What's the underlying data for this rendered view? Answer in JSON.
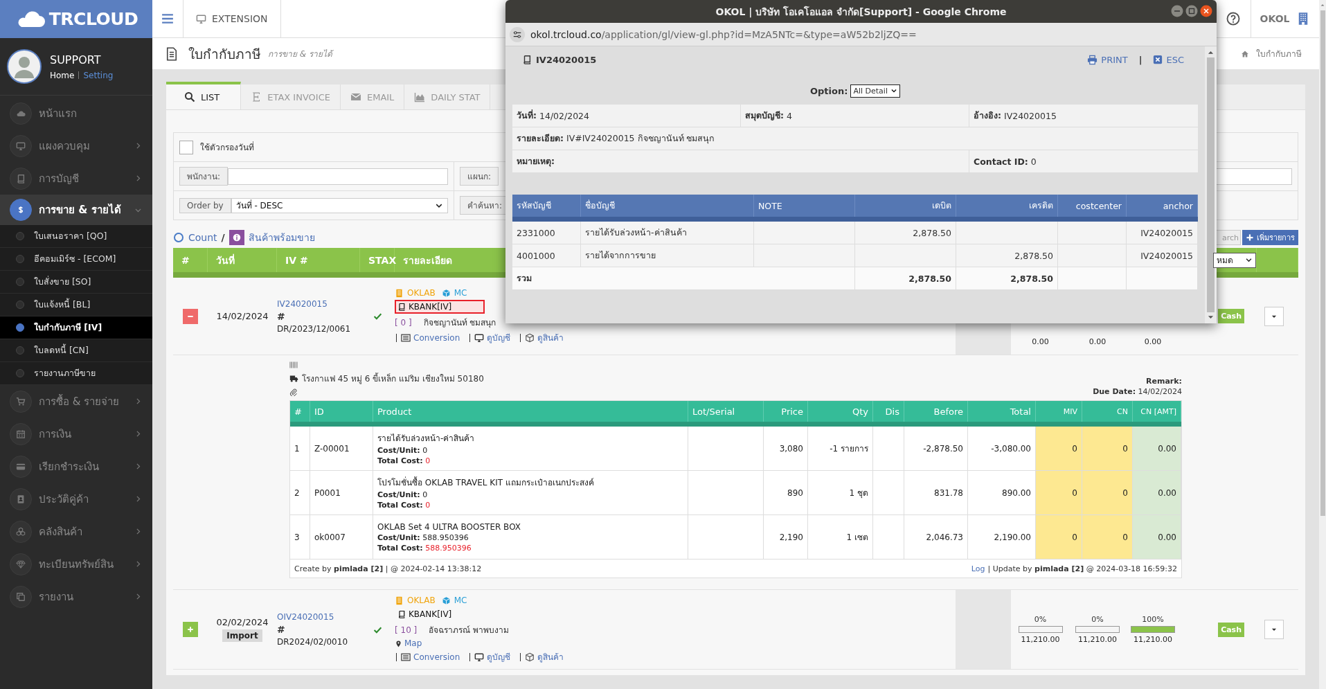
{
  "app": {
    "logo": "TRCLOUD",
    "user": "SUPPORT",
    "home_link": "Home",
    "setting_link": "Setting",
    "extension": "EXTENSION",
    "company": "OKOL"
  },
  "sidebar": {
    "items": [
      {
        "label": "หน้าแรก",
        "selected": false
      },
      {
        "label": "แผงควบคุม",
        "selected": false,
        "expanded": false
      },
      {
        "label": "การบัญชี",
        "selected": false,
        "expanded": false
      },
      {
        "label": "การขาย & รายได้",
        "selected": true,
        "expanded": true,
        "children": [
          {
            "label": "ใบเสนอราคา [QO]",
            "selected": false
          },
          {
            "label": "อีคอมเมิร์ซ - [ECOM]",
            "selected": false
          },
          {
            "label": "ใบสั่งขาย [SO]",
            "selected": false
          },
          {
            "label": "ใบแจ้งหนี้ [BL]",
            "selected": false
          },
          {
            "label": "ใบกำกับภาษี [IV]",
            "selected": true
          },
          {
            "label": "ใบลดหนี้ [CN]",
            "selected": false
          },
          {
            "label": "รายงานภาษีขาย",
            "selected": false
          }
        ]
      },
      {
        "label": "การซื้อ & รายจ่าย",
        "selected": false,
        "expanded": false
      },
      {
        "label": "การเงิน",
        "selected": false,
        "expanded": false
      },
      {
        "label": "เรียกชำระเงิน",
        "selected": false,
        "expanded": false
      },
      {
        "label": "ประวัติคู่ค้า",
        "selected": false,
        "expanded": false
      },
      {
        "label": "คลังสินค้า",
        "selected": false,
        "expanded": false
      },
      {
        "label": "ทะเบียนทรัพย์สิน",
        "selected": false,
        "expanded": false
      },
      {
        "label": "รายงาน",
        "selected": false,
        "expanded": false
      }
    ]
  },
  "page": {
    "title": "ใบกำกับภาษี",
    "subtitle": "การขาย & รายได้",
    "breadcrumb": "ใบกำกับภาษี"
  },
  "tabs": [
    {
      "label": "LIST",
      "selected": true
    },
    {
      "label": "ETAX INVOICE",
      "selected": false
    },
    {
      "label": "EMAIL",
      "selected": false
    },
    {
      "label": "DAILY STAT",
      "selected": false
    }
  ],
  "filters": {
    "date_filter": {
      "label": "ใช้ตัวกรองวันที่",
      "checked": false
    },
    "employee_label": "พนักงาน:",
    "department_label": "แผนก:",
    "order_label": "Order by",
    "order_value": "วันที่ - DESC",
    "search_label": "คำค้นหา:"
  },
  "toolbar": {
    "count": "Count",
    "separator": "/",
    "stock_link": "สินค้าพร้อมขาย",
    "search_button": "arch",
    "add_button": "เพิ่มรายการ"
  },
  "table": {
    "columns": [
      "#",
      "วันที่",
      "IV #",
      "STAX",
      "รายละเอียด"
    ],
    "status_select": "หมด",
    "rows": [
      {
        "expanded": true,
        "date": "14/02/2024",
        "iv": "IV24020015",
        "hash": "#",
        "ref": "DR/2023/12/0061",
        "stax": true,
        "company": "OKLAB",
        "branch": "MC",
        "book": "KBANK[IV]",
        "highlighted": true,
        "contact_code": "[ 0 ]",
        "contact": "กิจชญานันท์ ชมสนุก",
        "links": [
          "Conversion",
          "ดูบัญชี",
          "ดูสินค้า"
        ],
        "progress": [
          {
            "amount": "0.00"
          },
          {
            "amount": "0.00"
          },
          {
            "amount": "0.00"
          }
        ],
        "payment": "Cash",
        "detail": {
          "address": "โรงกาแฟ 45 หมู่ 6 ขี้เหล็ก แม่ริม เชียงใหม่ 50180",
          "remark_label": "Remark:",
          "due_label": "Due Date:",
          "due_date": "14/02/2024",
          "columns": [
            "#",
            "ID",
            "Product",
            "Lot/Serial",
            "Price",
            "Qty",
            "Dis",
            "Before",
            "Total",
            "MIV",
            "CN",
            "CN [AMT]"
          ],
          "items": [
            {
              "no": "1",
              "id": "Z-00001",
              "product": "รายได้รับล่วงหน้า-ค่าสินค้า",
              "cost_unit_label": "Cost/Unit:",
              "cost_unit": "0",
              "total_cost_label": "Total Cost:",
              "total_cost": "0",
              "price": "3,080",
              "qty": "-1 รายการ",
              "before": "-2,878.50",
              "total": "-3,080.00",
              "miv": "0",
              "cn": "0",
              "cn_amt": "0.00"
            },
            {
              "no": "2",
              "id": "P0001",
              "product": "โปรโมชั่นซื้อ OKLAB TRAVEL KIT แถมกระเป๋าอเนกประสงค์",
              "cost_unit_label": "Cost/Unit:",
              "cost_unit": "0",
              "total_cost_label": "Total Cost:",
              "total_cost": "0",
              "price": "890",
              "qty": "1 ชุด",
              "before": "831.78",
              "total": "890.00",
              "miv": "0",
              "cn": "0",
              "cn_amt": "0.00"
            },
            {
              "no": "3",
              "id": "ok0007",
              "product": "OKLAB Set 4 ULTRA BOOSTER BOX",
              "cost_unit_label": "Cost/Unit:",
              "cost_unit": "588.950396",
              "total_cost_label": "Total Cost:",
              "total_cost": "588.950396",
              "price": "2,190",
              "qty": "1 เซต",
              "before": "2,046.73",
              "total": "2,190.00",
              "miv": "0",
              "cn": "0",
              "cn_amt": "0.00"
            }
          ],
          "created": "Create by **pimlada [2]** | @ 2024-02-14 13:38:12",
          "log_link": "Log",
          "updated": "| Update by **pimlada [2]** @ 2024-03-18 16:59:32"
        }
      },
      {
        "expanded": false,
        "date": "02/02/2024",
        "badge": "Import",
        "iv": "OIV24020015",
        "hash": "#",
        "ref": "DR2024/02/0010",
        "stax": true,
        "company": "OKLAB",
        "branch": "MC",
        "book": "KBANK[IV]",
        "highlighted": false,
        "contact_code": "[ 10 ]",
        "contact": "อัจฉราภรณ์ พาพบงาม",
        "map": "Map",
        "links": [
          "Conversion",
          "ดูบัญชี",
          "ดูสินค้า"
        ],
        "progress": [
          {
            "percent": "0%",
            "level": 0,
            "amount": "11,210.00"
          },
          {
            "percent": "0%",
            "level": 0,
            "amount": "11,210.00"
          },
          {
            "percent": "100%",
            "level": 1,
            "amount": "11,210.00"
          }
        ],
        "payment": "Cash"
      }
    ]
  },
  "popup": {
    "title": "OKOL | บริษัท โอเคโอแอล จำกัด[Support] - Google Chrome",
    "url": "okol.trcloud.co/application/gl/view-gl.php?id=MzA5NTc=&type=aW52b2ljZQ==",
    "doc": "IV24020015",
    "print": "PRINT",
    "separator": "|",
    "esc": "ESC",
    "option_label": "Option:",
    "option_value": "All Detail",
    "info": [
      [
        {
          "label": "วันที่:",
          "value": "14/02/2024"
        },
        {
          "label": "สมุดบัญชี:",
          "value": "4"
        },
        {
          "label": "อ้างอิง:",
          "value": "IV24020015"
        }
      ],
      [
        {
          "label": "รายละเอียด:",
          "value": "IV#IV24020015 กิจชญานันท์ ชมสนุก"
        }
      ],
      [
        {
          "label": "หมายเหตุ:"
        },
        {
          "label": "Contact ID:",
          "value": "0"
        }
      ]
    ],
    "gl": {
      "columns": [
        "รหัสบัญชี",
        "ชื่อบัญชี",
        "NOTE",
        "เดบิต",
        "เครดิต",
        "costcenter",
        "anchor"
      ],
      "rows": [
        [
          "2331000",
          "รายได้รับล่วงหน้า-ค่าสินค้า",
          null,
          "2,878.50",
          null,
          null,
          "IV24020015"
        ],
        [
          "4001000",
          "รายได้จากการขาย",
          null,
          null,
          "2,878.50",
          null,
          "IV24020015"
        ]
      ],
      "total": {
        "label": "รวม",
        "debit": "2,878.50",
        "credit": "2,878.50"
      }
    }
  }
}
